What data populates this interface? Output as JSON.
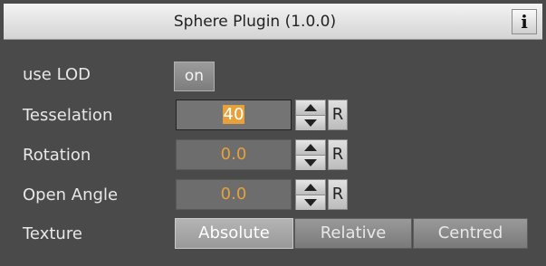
{
  "window": {
    "title": "Sphere Plugin (1.0.0)",
    "info_label": "i"
  },
  "fields": {
    "use_lod": {
      "label": "use LOD",
      "value": "on"
    },
    "tesselation": {
      "label": "Tesselation",
      "value": "40",
      "reset_label": "R"
    },
    "rotation": {
      "label": "Rotation",
      "value": "0.0",
      "reset_label": "R"
    },
    "open_angle": {
      "label": "Open Angle",
      "value": "0.0",
      "reset_label": "R"
    }
  },
  "texture": {
    "label": "Texture",
    "options": [
      "Absolute",
      "Relative",
      "Centred"
    ],
    "selected": "Absolute"
  },
  "icons": {
    "info": "info-icon",
    "spinner_up": "arrow-up-icon",
    "spinner_down": "arrow-down-icon"
  },
  "colors": {
    "panel_bg": "#4a4a4a",
    "field_bg": "#6d6d6d",
    "value_text": "#e8a13a",
    "label_text": "#e8e8e8"
  }
}
